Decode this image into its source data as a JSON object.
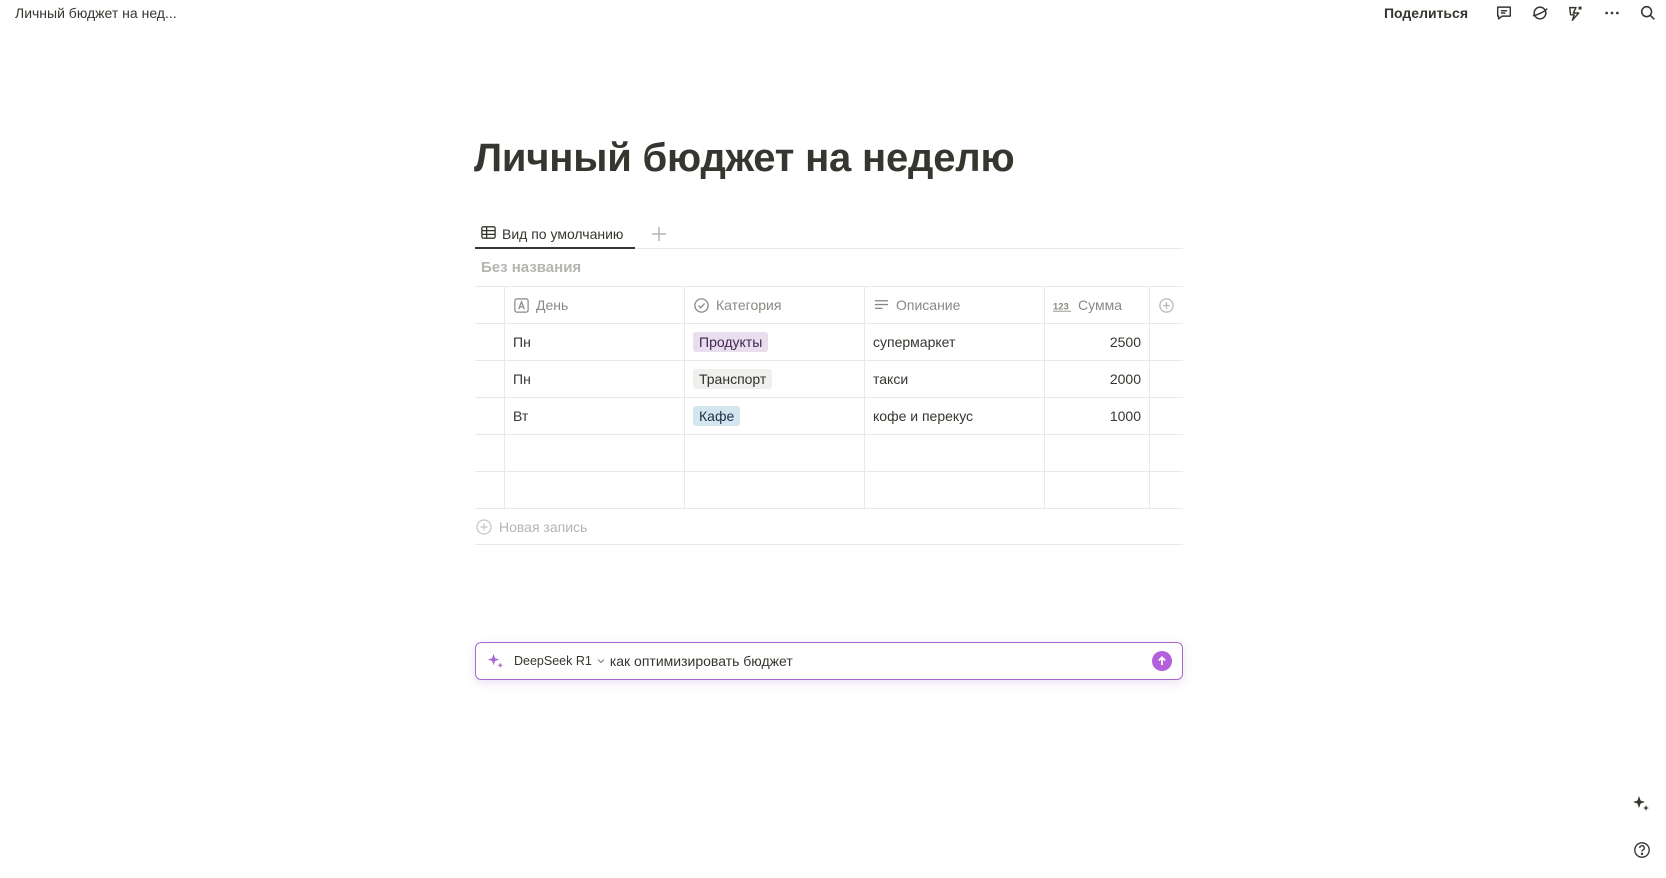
{
  "topbar": {
    "breadcrumb": "Личный бюджет на нед...",
    "share_label": "Поделиться",
    "icons": [
      "comment-icon",
      "sync-icon",
      "updates-icon",
      "more-icon",
      "search-icon"
    ]
  },
  "page": {
    "title": "Личный бюджет на неделю"
  },
  "views": {
    "active_tab_label": "Вид по умолчанию"
  },
  "database": {
    "title": "Без названия",
    "columns": {
      "day": "День",
      "category": "Категория",
      "description": "Описание",
      "sum": "Сумма"
    },
    "rows": [
      {
        "day": "Пн",
        "category": "Продукты",
        "description": "супермаркет",
        "sum": "2500"
      },
      {
        "day": "Пн",
        "category": "Транспорт",
        "description": "такси",
        "sum": "2000"
      },
      {
        "day": "Вт",
        "category": "Кафе",
        "description": "кофе и перекус",
        "sum": "1000"
      }
    ],
    "tag_colors": {
      "Продукты": {
        "bg": "#e8deee",
        "fg": "#412454"
      },
      "Транспорт": {
        "bg": "#efefed",
        "fg": "#32302c"
      },
      "Кафе": {
        "bg": "#d3e5ef",
        "fg": "#183347"
      }
    },
    "new_row_label": "Новая запись"
  },
  "ai_bar": {
    "model": "DeepSeek R1",
    "input_value": "как оптимизировать бюджет"
  },
  "colors": {
    "accent": "#a76bcf",
    "send_button": "#b45fdc",
    "text": "#37352f",
    "muted": "#8a8985"
  }
}
